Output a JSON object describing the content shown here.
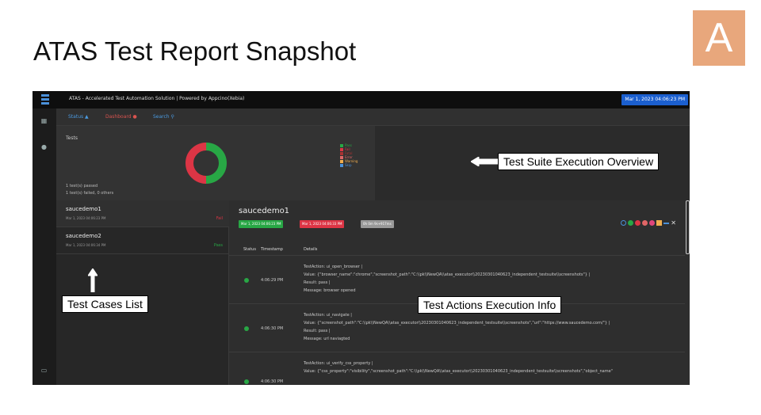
{
  "slide": {
    "title": "ATAS Test Report Snapshot",
    "badge_letter": "A"
  },
  "app": {
    "title": "ATAS - Accelerated Test Automation Solution | Powered by Appcino(Xebia)",
    "date_pill": "Mar 1, 2023 04:06:23 PM",
    "tabs": {
      "status": "Status",
      "dashboard": "Dashboard",
      "search": "Search"
    },
    "overview": {
      "label": "Tests",
      "passed_summary": "1 test(s) passed",
      "failed_summary": "1 test(s) failed, 0 others",
      "donut": {
        "pass": 1,
        "fail": 1
      },
      "legend": [
        {
          "label": "Pass",
          "color": "#28a745"
        },
        {
          "label": "Fail",
          "color": "#dc3545"
        },
        {
          "label": "Fatal",
          "color": "#a83232"
        },
        {
          "label": "Error",
          "color": "#e06666"
        },
        {
          "label": "Warning",
          "color": "#f0ad4e"
        },
        {
          "label": "Skip",
          "color": "#4a90d9"
        }
      ]
    },
    "test_cases": [
      {
        "name": "saucedemo1",
        "time": "Mar 1, 2023 04:06:23 PM",
        "result": "Fail",
        "color": "#dc3545"
      },
      {
        "name": "saucedemo2",
        "time": "Mar 1, 2023 04:06:34 PM",
        "result": "Pass",
        "color": "#28a745"
      }
    ],
    "detail": {
      "title": "saucedemo1",
      "start": "Mar 1, 2023 04:06:23 PM",
      "end": "Mar 1, 2023 04:06:33 PM",
      "duration": "0h 0m 9s+917ms",
      "columns": {
        "status": "Status",
        "timestamp": "Timestamp",
        "details": "Details"
      },
      "rows": [
        {
          "time": "4:06:29 PM",
          "lines": [
            "TestAction: ui_open_browser |",
            "Value: {\"browser_name\":\"chrome\",\"screenshot_path\":\"C:\\\\pk\\\\NewQA\\\\atas_executor\\\\20230301040623_independent_testsuite\\\\screenshots\"} |",
            "Result: pass |",
            "Message: browser opened"
          ]
        },
        {
          "time": "4:06:30 PM",
          "lines": [
            "TestAction: ui_navigate |",
            "Value: {\"screenshot_path\":\"C:\\\\pk\\\\NewQA\\\\atas_executor\\\\20230301040623_independent_testsuite\\\\screenshots\",\"url\":\"https://www.saucedemo.com/\"} |",
            "Result: pass |",
            "Message: url naviagted"
          ]
        },
        {
          "time": "4:06:30 PM",
          "lines": [
            "TestAction: ui_verify_css_property |",
            "Value: {\"css_property\":\"visibility\",\"screenshot_path\":\"C:\\\\pk\\\\NewQA\\\\atas_executor\\\\20230301040623_independent_testsuite\\\\screenshots\",\"object_name\""
          ]
        }
      ]
    }
  },
  "callouts": {
    "overview": "Test Suite Execution Overview",
    "cases": "Test Cases List",
    "actions": "Test Actions Execution Info"
  }
}
